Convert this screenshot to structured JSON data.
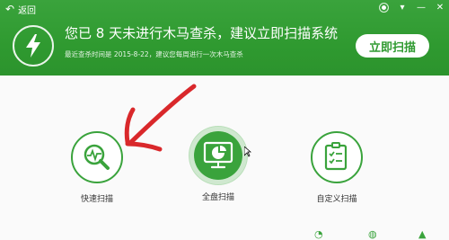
{
  "header": {
    "back_label": "返回",
    "headline": "您已 8 天未进行木马查杀，建议立即扫描系统",
    "subline": "最近查杀时间是 2015-8-22，建议您每周进行一次木马查杀",
    "scan_now_label": "立即扫描",
    "icons": [
      "back-arrow-icon",
      "skin-icon",
      "menu-icon",
      "minimize-icon",
      "close-icon",
      "lightning-icon"
    ]
  },
  "tools": [
    {
      "label": "快速扫描",
      "icon": "pulse-magnifier-icon"
    },
    {
      "label": "全盘扫描",
      "icon": "monitor-pie-icon"
    },
    {
      "label": "自定义扫描",
      "icon": "checklist-icon"
    }
  ],
  "annotation": {
    "color": "#d9282b",
    "shape": "hand-drawn red arrow pointing at quick scan"
  },
  "colors": {
    "brand_green": "#3aa33c",
    "header_green": "#2f9a30",
    "text": "#333333"
  }
}
